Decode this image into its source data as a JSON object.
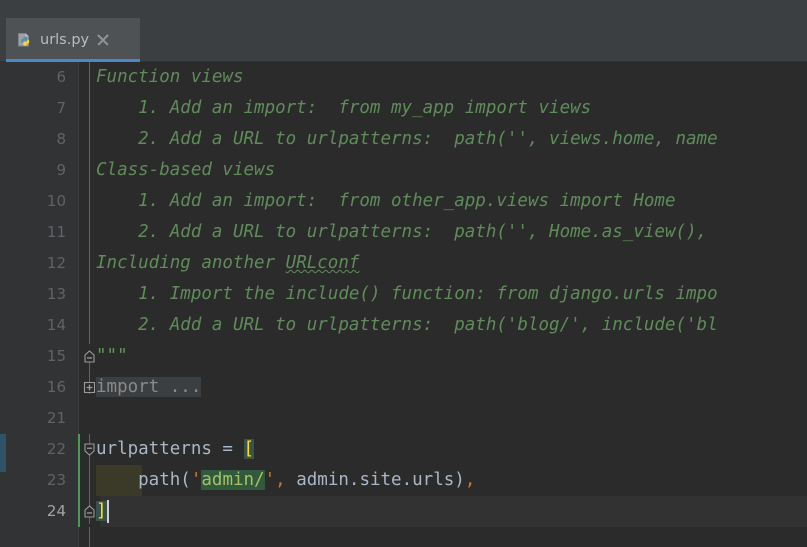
{
  "window": {
    "theme": "darcula",
    "background": "#2b2b2b",
    "chrome_background": "#3c3f41"
  },
  "tabbar": {
    "tabs": [
      {
        "label": "urls.py",
        "icon": "python-file-icon",
        "close_icon": "close-icon",
        "active": true,
        "underline_color": "#4a88c7"
      }
    ]
  },
  "editor": {
    "gutter": {
      "line_numbers": [
        "6",
        "7",
        "8",
        "9",
        "10",
        "11",
        "12",
        "13",
        "14",
        "15",
        "16",
        "21",
        "22",
        "23",
        "24"
      ],
      "current_line_number": "24"
    },
    "fold_markers": [
      {
        "line": "15",
        "type": "fold-end-marker",
        "glyph": "minus"
      },
      {
        "line": "16",
        "type": "expand-marker",
        "glyph": "plus"
      },
      {
        "line": "22",
        "type": "fold-start-marker",
        "glyph": "minus"
      },
      {
        "line": "24",
        "type": "fold-end-marker",
        "glyph": "minus"
      }
    ],
    "change_marker_color": "#499c54",
    "caret_line": "24",
    "lines": [
      {
        "number": "6",
        "kind": "docstring",
        "text": "Function views"
      },
      {
        "number": "7",
        "kind": "docstring",
        "text": "    1. Add an import:  from my_app import views"
      },
      {
        "number": "8",
        "kind": "docstring",
        "text": "    2. Add a URL to urlpatterns:  path('', views.home, name",
        "truncated": true
      },
      {
        "number": "9",
        "kind": "docstring",
        "text": "Class-based views"
      },
      {
        "number": "10",
        "kind": "docstring",
        "text": "    1. Add an import:  from other_app.views import Home"
      },
      {
        "number": "11",
        "kind": "docstring",
        "text": "    2. Add a URL to urlpatterns:  path('', Home.as_view(),",
        "truncated": true
      },
      {
        "number": "12",
        "kind": "docstring",
        "text_before": "Including another ",
        "typo_word": "URLconf",
        "text_after": ""
      },
      {
        "number": "13",
        "kind": "docstring",
        "text": "    1. Import the include() function: from django.urls impo",
        "truncated": true
      },
      {
        "number": "14",
        "kind": "docstring",
        "text": "    2. Add a URL to urlpatterns:  path('blog/', include('bl",
        "truncated": true
      },
      {
        "number": "15",
        "kind": "docstring-close",
        "text": "\"\"\""
      },
      {
        "number": "16",
        "kind": "folded-import",
        "text": "import ..."
      },
      {
        "number": "21",
        "kind": "blank",
        "text": ""
      },
      {
        "number": "22",
        "kind": "code",
        "segments": [
          {
            "text": "urlpatterns = ",
            "style": "plain"
          },
          {
            "text": "[",
            "style": "bracket-match"
          }
        ]
      },
      {
        "number": "23",
        "kind": "code",
        "segments": [
          {
            "text": "    path(",
            "style": "plain"
          },
          {
            "text": "'",
            "style": "quote"
          },
          {
            "text": "admin/",
            "style": "usage-highlight"
          },
          {
            "text": "'",
            "style": "quote"
          },
          {
            "text": ",",
            "style": "comma"
          },
          {
            "text": " admin.site.urls)",
            "style": "plain"
          },
          {
            "text": ",",
            "style": "comma"
          }
        ]
      },
      {
        "number": "24",
        "kind": "code",
        "segments": [
          {
            "text": "]",
            "style": "bracket-match"
          }
        ]
      }
    ]
  },
  "colors": {
    "docstring": "#5f8c5a",
    "docstring_quotes": "#629755",
    "plain_text": "#a9b7c6",
    "string": "#6a8759",
    "punctuation": "#cc7832",
    "bracket_match_fg": "#ffe400",
    "bracket_match_bg": "#3b514d",
    "usage_highlight_bg": "#32593d",
    "current_line_bg": "#323232",
    "indent_block_bg": "#3b3a28",
    "gutter_bg": "#313335",
    "line_number_fg": "#606366"
  }
}
